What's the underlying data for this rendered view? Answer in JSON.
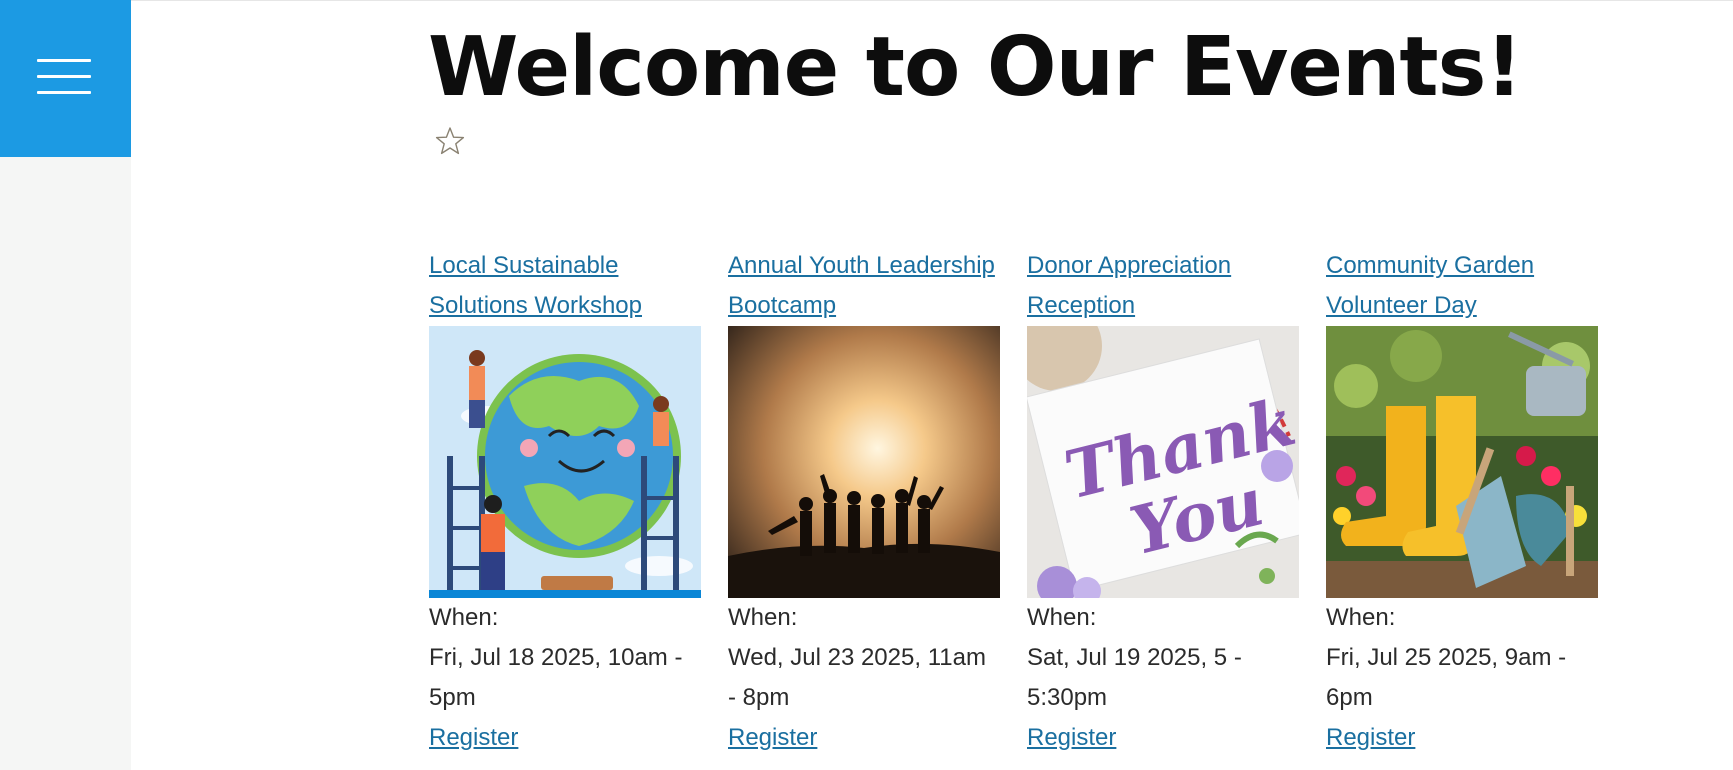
{
  "header": {
    "title": "Welcome to Our Events!",
    "menu_icon": "hamburger-menu-icon",
    "favorite_icon": "star-outline-icon"
  },
  "colors": {
    "menu_button": "#1c9ae3",
    "link": "#1a6fa0",
    "sidebar": "#f5f6f5"
  },
  "events": [
    {
      "title": "Local Sustainable Solutions Workshop",
      "image": "earth-with-volunteers-illustration",
      "when_label": "When:",
      "when": "Fri, Jul 18 2025, 10am - 5pm",
      "register_label": "Register"
    },
    {
      "title": "Annual Youth Leadership Bootcamp",
      "image": "group-silhouette-sunset-photo",
      "when_label": "When:",
      "when": "Wed, Jul 23 2025, 11am - 8pm",
      "register_label": "Register"
    },
    {
      "title": "Donor Appreciation Reception",
      "image": "thank-you-card-photo",
      "when_label": "When:",
      "when": "Sat, Jul 19 2025, 5 - 5:30pm",
      "register_label": "Register"
    },
    {
      "title": "Community Garden Volunteer Day",
      "image": "garden-boots-and-tools-photo",
      "when_label": "When:",
      "when": "Fri, Jul 25 2025, 9am - 6pm",
      "register_label": "Register"
    }
  ],
  "images": {
    "card_thank_you_line1": "Thank",
    "card_thank_you_line2": "You"
  }
}
